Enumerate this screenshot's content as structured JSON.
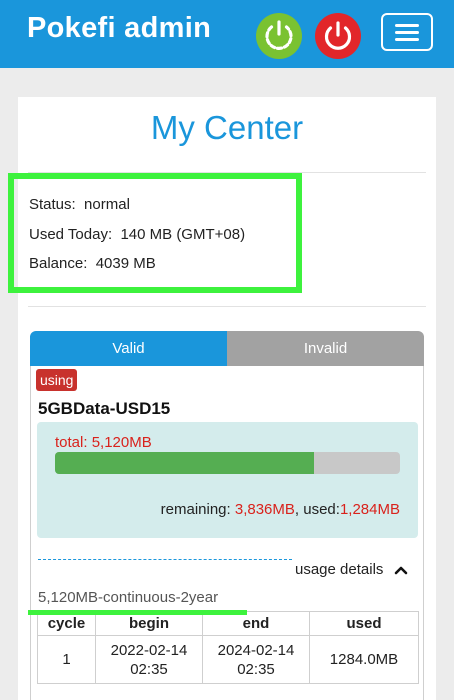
{
  "header": {
    "title": "Pokefi admin"
  },
  "page": {
    "title": "My Center"
  },
  "info": {
    "status_label": "Status:",
    "status_value": "normal",
    "used_label": "Used Today:",
    "used_value": "140 MB (GMT+08)",
    "balance_label": "Balance:",
    "balance_value": "4039 MB"
  },
  "tabs": {
    "valid": "Valid",
    "invalid": "Invalid"
  },
  "package": {
    "badge": "using",
    "name": "5GBData-USD15",
    "total_label": "total:",
    "total_value": "5,120MB",
    "used_fraction": 0.75,
    "remaining_label": "remaining:",
    "remaining_value": "3,836MB",
    "separator": ",",
    "used_label": "used:",
    "used_value": "1,284MB",
    "details_label": "usage details",
    "description": "5,120MB-continuous-2year"
  },
  "cycle_table": {
    "headers": [
      "cycle",
      "begin",
      "end",
      "used"
    ],
    "rows": [
      {
        "cycle": "1",
        "begin_date": "2022-02-14",
        "begin_time": "02:35",
        "end_date": "2024-02-14",
        "end_time": "02:35",
        "used": "1284.0MB"
      }
    ]
  },
  "colors": {
    "primary": "#1a96db",
    "danger": "#e2262a",
    "success": "#7ac231",
    "highlight": "#3df23d"
  }
}
